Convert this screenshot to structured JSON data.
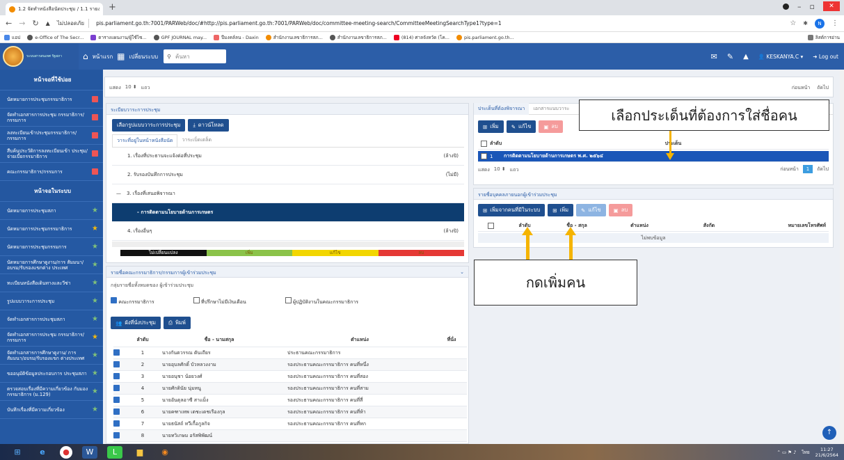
{
  "browser": {
    "tab_title": "1.2 จัดทำหนังสือนัดประชุม / 1.1 รายงาน ×",
    "url_warning": "ไม่ปลอดภัย",
    "url": "pis.parliament.go.th:7001/PARWeb/doc/#http://pis.parliament.go.th:7001/PARWeb/doc/committee-meeting-search/CommitteeMeetingSearchType1?type=1",
    "bookmarks": [
      "แอป",
      "e-Office of The Secr...",
      "ตารางแผนงาน/ผู้ใช้ไซ...",
      "GPF JOURNAL may...",
      "ปีมงคล์ลน - Daxin",
      "สำนักงานเลขาธิการสภ...",
      "สำนักงานเลขาธิการสภ...",
      "(814) ศาลจังหวัด (โค...",
      "pis.parliament.go.th..."
    ],
    "reading_list": "ลิสต์การอ่าน"
  },
  "app": {
    "logo_text": "ระบบสารสนเทศ\nรัฐสภา",
    "home_label": "หน้าแรก",
    "switch_label": "เปลี่ยนระบบ",
    "search_placeholder": "ค้นหา",
    "username": "KESKANYA.C",
    "logout_label": "Log out"
  },
  "sidebar": {
    "items": [
      {
        "label": "หน้าจอที่ใช้บ่อย",
        "type": "head"
      },
      {
        "label": "นัดหมายการประชุมกรรมาธิการ",
        "mark": "red"
      },
      {
        "label": "จัดทำเอกสารการประชุม กรรมาธิการ/กรรมการ",
        "mark": "red"
      },
      {
        "label": "ลงทะเบียนเข้าประชุมกรรมาธิการ/ กรรมการ",
        "mark": "red"
      },
      {
        "label": "สืบค้นประวัติการลงทะเบียนเข้า ประชุม/จ่ายเบี้ยกรรมาธิการ",
        "mark": "red"
      },
      {
        "label": "คณะกรรมาธิการ/กรรมการ",
        "mark": "red"
      },
      {
        "label": "หน้าจอในระบบ",
        "type": "head"
      },
      {
        "label": "นัดหมายการประชุมสภา",
        "mark": "star"
      },
      {
        "label": "นัดหมายการประชุมกรรมาธิการ",
        "mark": "gold"
      },
      {
        "label": "นัดหมายการประชุมกรรมการ",
        "mark": "star"
      },
      {
        "label": "นัดหมายการศึกษาดูงาน/การ สัมมนา/อบรม/รับรองแขกต่าง ประเทศ",
        "mark": "star"
      },
      {
        "label": "ทะเบียนหนังสือเดินทางและวีซ่า",
        "mark": "star"
      },
      {
        "label": "รูปแบบวาระการประชุม",
        "mark": "star"
      },
      {
        "label": "จัดทำเอกสารการประชุมสภา",
        "mark": "star"
      },
      {
        "label": "จัดทำเอกสารการประชุม กรรมาธิการ/กรรมการ",
        "mark": "gold"
      },
      {
        "label": "จัดทำเอกสารการศึกษาดูงาน/ การสัมมนา/อบรม/รับรองแขก ต่างประเทศ",
        "mark": "star"
      },
      {
        "label": "ขออนุมัติข้อมูลประกอบการ ประชุมสภา",
        "mark": "star"
      },
      {
        "label": "ตรวจสอบเรื่องที่มีความเกี่ยวข้อง กับมองกรรมาธิการ (ม.129)",
        "mark": "star"
      },
      {
        "label": "บันทึกเรื่องที่มีความเกี่ยวข้อง",
        "mark": "star"
      }
    ]
  },
  "top_strip": {
    "show_label": "แสดง",
    "show_value": "10",
    "rows_label": "แถว",
    "prev": "ก่อนหน้า",
    "next": "ถัดไป"
  },
  "agenda_panel": {
    "title": "ระเบียบวาระการประชุม",
    "select_format_btn": "เลือกรูปแบบวาระการประชุม",
    "download_btn": "ดาวน์โหลด",
    "tab_active": "วาระที่อยู่ในหน้าหนังสือนัด",
    "tab_other": "วาระเบ็ดเตล็ด",
    "items": [
      {
        "text": "1. เรื่องที่ประธานจะแจ้งต่อที่ประชุม",
        "tag": "(ล้างปิ)"
      },
      {
        "text": "2. รับรองบันทึกการประชุม",
        "tag": "(ไม่มี)"
      },
      {
        "text": "3. เรื่องที่เสนอพิจารณา",
        "tag": ""
      },
      {
        "text": "- การติดตามนโยบายด้านการเกษตร",
        "tag": ""
      },
      {
        "text": "4. เรื่องอื่นๆ",
        "tag": "(ล้างปิ)"
      }
    ],
    "legend": [
      "ไม่เปลี่ยนแปลง",
      "เพิ่ม",
      "แก้ไข",
      "ลบ"
    ]
  },
  "committee_panel": {
    "title": "รายชื่อคณะกรรมาธิการ/กรรมการผู้เข้าร่วมประชุม",
    "subtitle": "กลุ่มรายชื่อทั้งหมดของ ผู้เข้าร่วมประชุม",
    "check1": "คณะกรรมาธิการ",
    "check2": "ที่ปรึกษาไม่มีเงินเดือน",
    "check3": "ผู้ปฏิบัติงานในคณะกรรมาธิการ",
    "seat_btn": "ผังที่นั่งประชุม",
    "print_btn": "พิมพ์",
    "columns": [
      "ลำดับ",
      "ชื่อ - นามสกุล",
      "ตำแหน่ง",
      "ที่นั่ง"
    ],
    "rows": [
      {
        "no": "1",
        "name": "นางกันตวรรณ ตันเถียร",
        "pos": "ประธานคณะกรรมาธิการ"
      },
      {
        "no": "2",
        "name": "นายอุบลศักดิ์ บัวหลวงงาม",
        "pos": "รองประธานคณะกรรมาธิการ คนที่หนึ่ง"
      },
      {
        "no": "3",
        "name": "นายอนุชา น้อยวงศ์",
        "pos": "รองประธานคณะกรรมาธิการ คนที่สอง"
      },
      {
        "no": "4",
        "name": "นายศักดินัย นุ่มหนู",
        "pos": "รองประธานคณะกรรมาธิการ คนที่สาม"
      },
      {
        "no": "5",
        "name": "นายอันตุลอาซี สาแม็ง",
        "pos": "รองประธานคณะกรรมาธิการ คนที่สี่"
      },
      {
        "no": "6",
        "name": "นายคฑาเทพ เตชะเดชเรืองกุล",
        "pos": "รองประธานคณะกรรมาธิการ คนที่ห้า"
      },
      {
        "no": "7",
        "name": "นายธนัสถ์ ทวีเกื้อกูลกิจ",
        "pos": "รองประธานคณะกรรมาธิการ คนที่หก"
      },
      {
        "no": "8",
        "name": "นายทวิเกษม อรัสพิพัฒน์",
        "pos": ""
      }
    ]
  },
  "issue_panel": {
    "tab_active": "ประเด็นที่ต้องพิจารณา",
    "tab_other": "เอกสารแนบวาระ",
    "add_btn": "เพิ่ม",
    "edit_btn": "แก้ไข",
    "delete_btn": "ลบ",
    "columns": [
      "ลำดับ",
      "ประเด็น"
    ],
    "row_no": "1",
    "row_text": "การติดตามนโยบายด้านการเกษตร พ.ศ. ๒๕๖๔",
    "show_label": "แสดง",
    "show_value": "10",
    "rows_label": "แถว",
    "prev": "ก่อนหน้า",
    "page": "1",
    "next": "ถัดไป"
  },
  "outsider_panel": {
    "title": "รายชื่อบุคคลภายนอกผู้เข้าร่วมประชุม",
    "add_from_system_btn": "เพิ่มจากคนที่มีในระบบ",
    "add_btn": "เพิ่ม",
    "edit_btn": "แก้ไข",
    "delete_btn": "ลบ",
    "columns": [
      "ลำดับ",
      "ชื่อ - สกุล",
      "ตำแหน่ง",
      "สังกัด",
      "หมายเลขโทรศัพท์"
    ],
    "empty": "ไม่พบข้อมูล"
  },
  "annotations": {
    "callout_top": "เลือกประเด็นที่ต้องการใส่ชื่อคน",
    "callout_bottom": "กดเพิ่มคน"
  },
  "taskbar": {
    "time": "11:27",
    "date": "21/6/2564",
    "lang": "ไทย"
  },
  "colors": {
    "header_blue": "#2c5ea8",
    "sidebar_blue": "#2559a3",
    "selected_row": "#1a56b8",
    "legend_black": "#111111",
    "legend_green": "#8bc34a",
    "legend_yellow": "#f2d600",
    "legend_red": "#e53935",
    "arrow": "#f5b400"
  }
}
